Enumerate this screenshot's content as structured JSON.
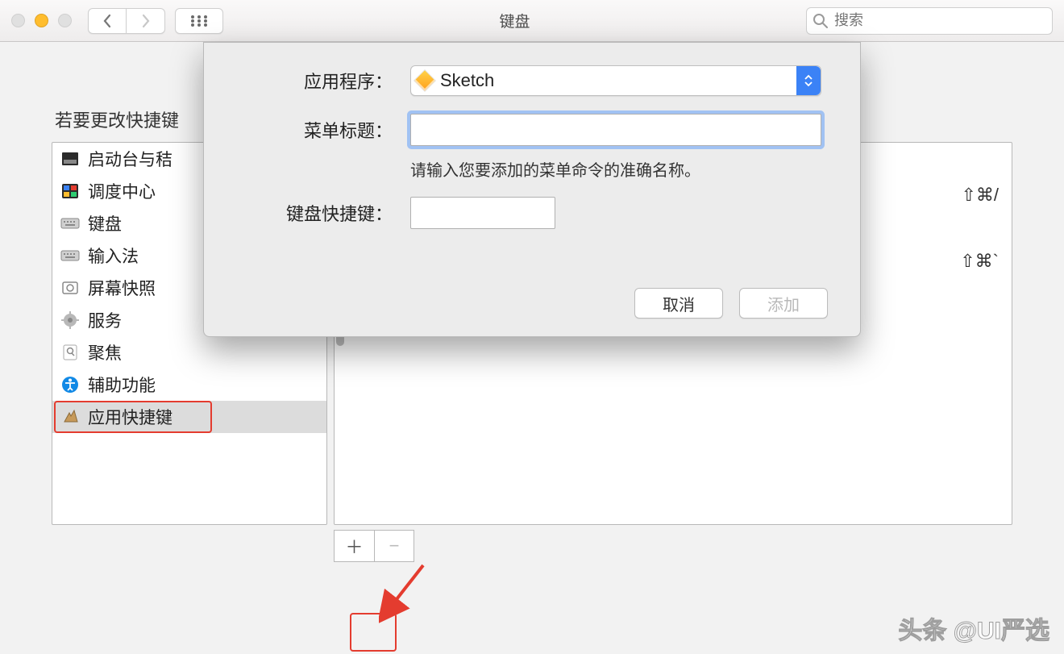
{
  "window": {
    "title": "键盘"
  },
  "search": {
    "placeholder": "搜索"
  },
  "description": "若要更改快捷键",
  "sidebar": {
    "items": [
      {
        "label": "启动台与秸"
      },
      {
        "label": "调度中心"
      },
      {
        "label": "键盘"
      },
      {
        "label": "输入法"
      },
      {
        "label": "屏幕快照"
      },
      {
        "label": "服务"
      },
      {
        "label": "聚焦"
      },
      {
        "label": "辅助功能"
      },
      {
        "label": "应用快捷键"
      }
    ]
  },
  "right": {
    "rows": [
      {
        "shortcut": "⇧⌘/"
      },
      {
        "shortcut": "⇧⌘`"
      }
    ]
  },
  "sheet": {
    "app_label": "应用程序：",
    "app_value": "Sketch",
    "menu_label": "菜单标题：",
    "menu_value": "",
    "hint": "请输入您要添加的菜单命令的准确名称。",
    "shortcut_label": "键盘快捷键：",
    "shortcut_value": "",
    "cancel": "取消",
    "add": "添加"
  },
  "footer": {
    "add": "＋",
    "remove": "−"
  },
  "watermark": "头条 @UI严选"
}
